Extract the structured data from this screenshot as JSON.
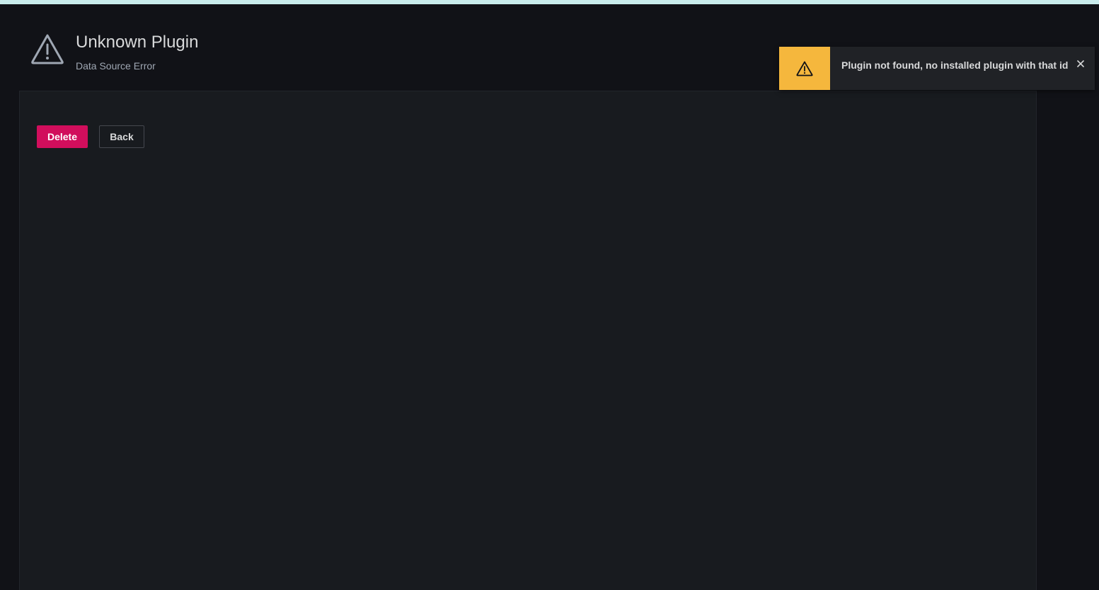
{
  "header": {
    "title": "Unknown Plugin",
    "subtitle": "Data Source Error",
    "icon": "exclamation-triangle-icon"
  },
  "actions": {
    "delete_label": "Delete",
    "back_label": "Back"
  },
  "toast": {
    "message": "Plugin not found, no installed plugin with that id",
    "icon": "exclamation-triangle-icon",
    "close_icon": "close-icon"
  },
  "colors": {
    "background": "#111217",
    "panel": "#181b1f",
    "accent_strip": "#c9ecec",
    "delete": "#d10e5c",
    "warning": "#f5b73d"
  }
}
